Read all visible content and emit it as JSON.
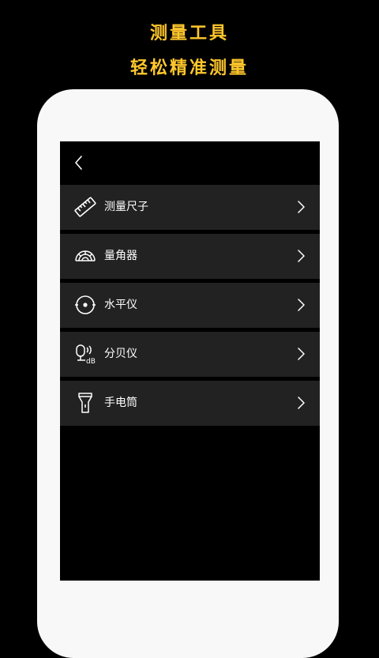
{
  "promo": {
    "line1": "测量工具",
    "line2": "轻松精准测量",
    "accent_color": "#ffc72c"
  },
  "topbar": {
    "back_icon": "chevron-left-icon"
  },
  "menu": {
    "items": [
      {
        "label": "测量尺子",
        "icon": "ruler-icon"
      },
      {
        "label": "量角器",
        "icon": "protractor-icon"
      },
      {
        "label": "水平仪",
        "icon": "level-icon"
      },
      {
        "label": "分贝仪",
        "icon": "decibel-meter-icon"
      },
      {
        "label": "手电筒",
        "icon": "flashlight-icon"
      }
    ]
  }
}
